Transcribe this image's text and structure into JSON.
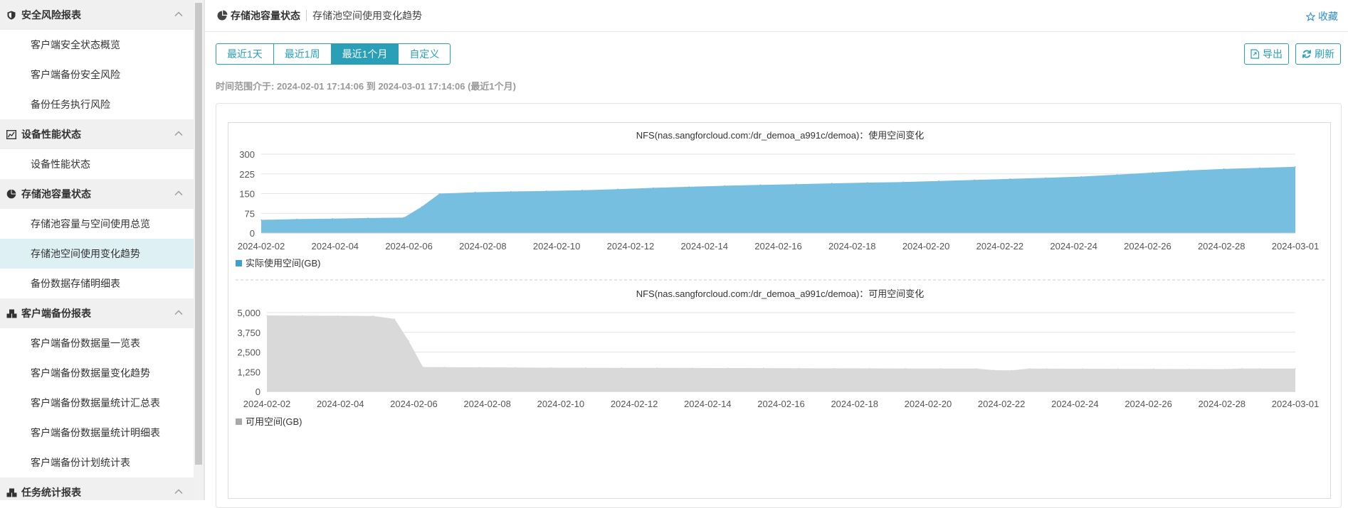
{
  "sidebar": {
    "sections": [
      {
        "title": "安全风险报表",
        "icon": "shield-icon",
        "items": [
          "客户端安全状态概览",
          "客户端备份安全风险",
          "备份任务执行风险"
        ]
      },
      {
        "title": "设备性能状态",
        "icon": "chart-icon",
        "items": [
          "设备性能状态"
        ]
      },
      {
        "title": "存储池容量状态",
        "icon": "pie-icon",
        "items": [
          "存储池容量与空间使用总览",
          "存储池空间使用变化趋势",
          "备份数据存储明细表"
        ]
      },
      {
        "title": "客户端备份报表",
        "icon": "cubes-icon",
        "items": [
          "客户端备份数据量一览表",
          "客户端备份数据量变化趋势",
          "客户端备份数据量统计汇总表",
          "客户端备份数据量统计明细表",
          "客户端备份计划统计表"
        ]
      },
      {
        "title": "任务统计报表",
        "icon": "cubes-icon",
        "items": []
      }
    ],
    "active_item": "存储池空间使用变化趋势"
  },
  "header": {
    "title": "存储池容量状态",
    "subtitle": "存储池空间使用变化趋势",
    "favorite_label": "收藏"
  },
  "range_buttons": [
    "最近1天",
    "最近1周",
    "最近1个月",
    "自定义"
  ],
  "range_active": "最近1个月",
  "toolbar": {
    "export_label": "导出",
    "refresh_label": "刷新"
  },
  "time_info": "时间范围介于: 2024-02-01 17:14:06 到 2024-03-01 17:14:06 (最近1个月)",
  "colors": {
    "accent": "#2a9fb8",
    "used_fill": "#77bfe0",
    "free_fill": "#d9d9d9",
    "used_legend": "#3e9fd1",
    "free_legend": "#a9a9a9"
  },
  "chart_data": [
    {
      "type": "area",
      "title": "NFS(nas.sangforcloud.com:/dr_demoa_a991c/demoa)：使用空间变化",
      "x_ticks": [
        "2024-02-02",
        "2024-02-04",
        "2024-02-06",
        "2024-02-08",
        "2024-02-10",
        "2024-02-12",
        "2024-02-14",
        "2024-02-16",
        "2024-02-18",
        "2024-02-20",
        "2024-02-22",
        "2024-02-24",
        "2024-02-26",
        "2024-02-28",
        "2024-03-01"
      ],
      "y_ticks": [
        "300",
        "225",
        "150",
        "75",
        "0"
      ],
      "ylim": [
        0,
        300
      ],
      "x_range_days": [
        1,
        30
      ],
      "grid": true,
      "legend_position": "bottom-left",
      "series": [
        {
          "name": "实际使用空间(GB)",
          "x": [
            1,
            2,
            3,
            4,
            5,
            5.5,
            6,
            7,
            8,
            9,
            10,
            11,
            12,
            13,
            14,
            15,
            16,
            17,
            18,
            19,
            20,
            21,
            22,
            23,
            24,
            25,
            26,
            27,
            28,
            29,
            30
          ],
          "y": [
            50,
            53,
            55,
            57,
            59,
            100,
            150,
            155,
            158,
            160,
            163,
            167,
            172,
            176,
            180,
            183,
            186,
            189,
            192,
            194,
            198,
            202,
            206,
            210,
            215,
            222,
            230,
            238,
            244,
            248,
            252
          ]
        }
      ]
    },
    {
      "type": "area",
      "title": "NFS(nas.sangforcloud.com:/dr_demoa_a991c/demoa)：可用空间变化",
      "x_ticks": [
        "2024-02-02",
        "2024-02-04",
        "2024-02-06",
        "2024-02-08",
        "2024-02-10",
        "2024-02-12",
        "2024-02-14",
        "2024-02-16",
        "2024-02-18",
        "2024-02-20",
        "2024-02-22",
        "2024-02-24",
        "2024-02-26",
        "2024-02-28",
        "2024-03-01"
      ],
      "y_ticks": [
        "5,000",
        "3,750",
        "2,500",
        "1,250",
        "0"
      ],
      "ylim": [
        0,
        5000
      ],
      "x_range_days": [
        1,
        30
      ],
      "grid": true,
      "legend_position": "bottom-left",
      "series": [
        {
          "name": "可用空间(GB)",
          "x": [
            1,
            2,
            3,
            4,
            4.6,
            5,
            5.4,
            6,
            7,
            8,
            9,
            10,
            11,
            12,
            13,
            14,
            15,
            16,
            17,
            18,
            19,
            20,
            21,
            21.5,
            22,
            22.5,
            23,
            24,
            25,
            26,
            27,
            28,
            28.5,
            29,
            30
          ],
          "y": [
            4820,
            4810,
            4800,
            4790,
            4600,
            3200,
            1550,
            1540,
            1530,
            1520,
            1510,
            1505,
            1500,
            1495,
            1490,
            1485,
            1480,
            1475,
            1470,
            1465,
            1460,
            1455,
            1450,
            1350,
            1340,
            1450,
            1445,
            1440,
            1435,
            1430,
            1425,
            1420,
            1460,
            1455,
            1450
          ]
        }
      ]
    }
  ]
}
